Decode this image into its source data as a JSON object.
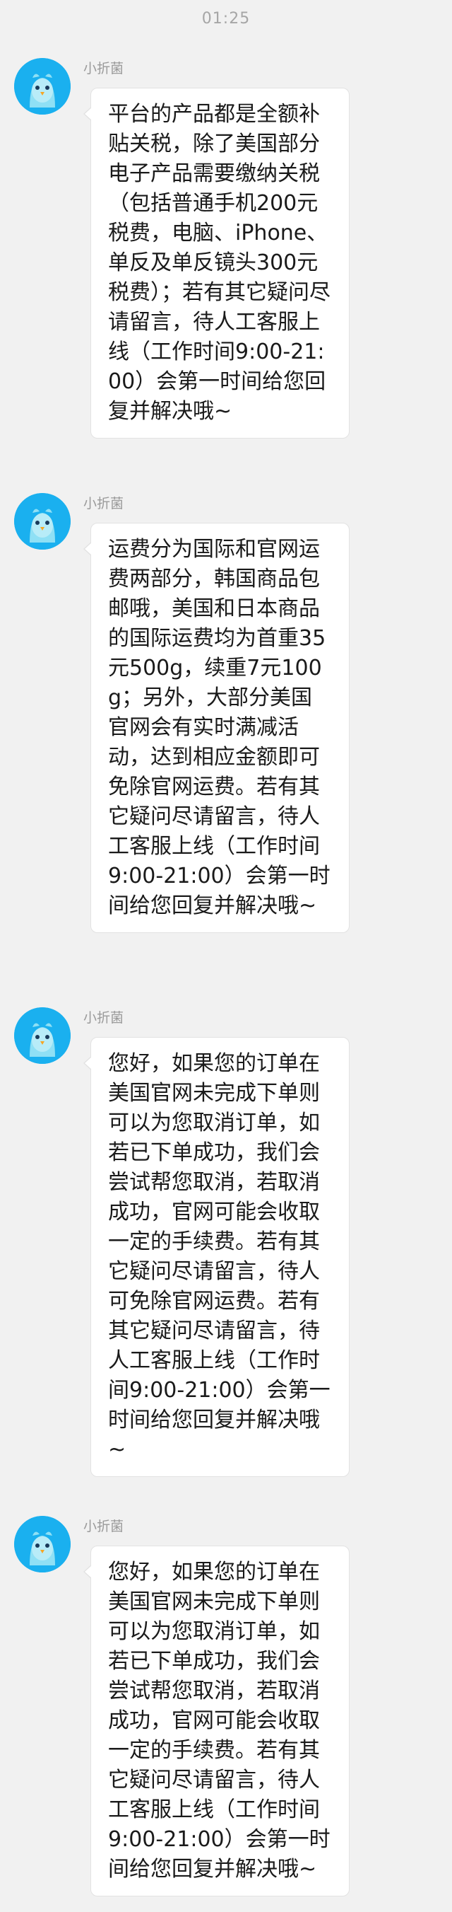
{
  "status": {
    "time": "01:25"
  },
  "colors": {
    "avatar": "#1ab0ef",
    "background": "#f1f1f1",
    "bubble": "#ffffff"
  },
  "messages": [
    {
      "sender": "小折菌",
      "text": "平台的产品都是全额补贴关税，除了美国部分电子产品需要缴纳关税（包括普通手机200元税费，电脑、iPhone、单反及单反镜头300元税费）；若有其它疑问尽请留言，待人工客服上线（工作时间9:00-21:00）会第一时间给您回复并解决哦~",
      "avatar_icon": "bird-mascot-icon"
    },
    {
      "sender": "小折菌",
      "text": "运费分为国际和官网运费两部分，韩国商品包邮哦，美国和日本商品的国际运费均为首重35元500g，续重7元100g；另外，大部分美国官网会有实时满减活动，达到相应金额即可免除官网运费。若有其它疑问尽请留言，待人工客服上线（工作时间9:00-21:00）会第一时间给您回复并解决哦~",
      "avatar_icon": "bird-mascot-icon"
    },
    {
      "sender": "小折菌",
      "text": "您好，如果您的订单在美国官网未完成下单则可以为您取消订单，如若已下单成功，我们会尝试帮您取消，若取消成功，官网可能会收取一定的手续费。若有其它疑问尽请留言，待人可免除官网运费。若有其它疑问尽请留言，待人工客服上线（工作时间9:00-21:00）会第一时间给您回复并解决哦~",
      "avatar_icon": "bird-mascot-icon"
    },
    {
      "sender": "小折菌",
      "text": "您好，如果您的订单在美国官网未完成下单则可以为您取消订单，如若已下单成功，我们会尝试帮您取消，若取消成功，官网可能会收取一定的手续费。若有其它疑问尽请留言，待人工客服上线（工作时间9:00-21:00）会第一时间给您回复并解决哦~",
      "avatar_icon": "bird-mascot-icon"
    }
  ]
}
